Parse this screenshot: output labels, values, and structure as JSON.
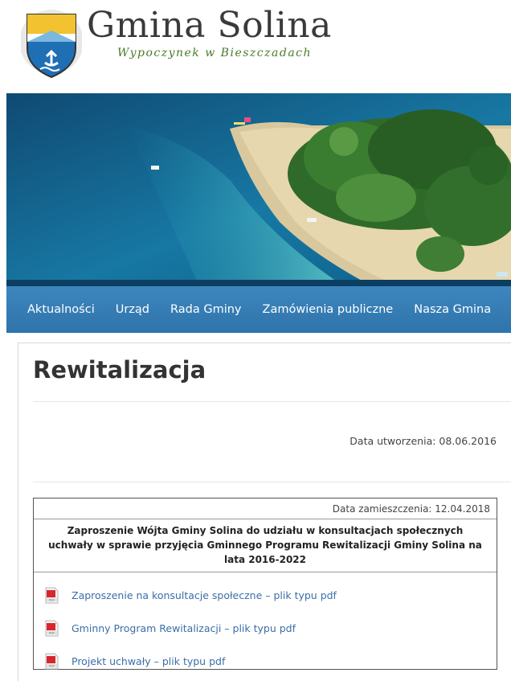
{
  "brand": {
    "title": "Gmina Solina",
    "subtitle": "Wypoczynek w Bieszczadach",
    "logo_icon": "crest-icon"
  },
  "nav": {
    "items": [
      {
        "label": "Aktualności"
      },
      {
        "label": "Urząd"
      },
      {
        "label": "Rada Gminy"
      },
      {
        "label": "Zamówienia publiczne"
      },
      {
        "label": "Nasza Gmina"
      }
    ],
    "color": "#357ab3"
  },
  "page": {
    "title": "Rewitalizacja",
    "created": "Data utworzenia: 08.06.2016"
  },
  "document": {
    "posted": "Data zamieszczenia: 12.04.2018",
    "title": "Zaproszenie Wójta Gminy Solina do udziału w konsultacjach społecznych uchwały w sprawie przyjęcia Gminnego Programu Rewitalizacji  Gminy  Solina na lata 2016-2022",
    "files": [
      {
        "label": "Zaproszenie na konsultacje społeczne – plik typu pdf",
        "icon": "pdf-icon"
      },
      {
        "label": "Gminny Program Rewitalizacji – plik typu pdf",
        "icon": "pdf-icon"
      },
      {
        "label": "Projekt uchwały – plik typu pdf",
        "icon": "pdf-icon"
      }
    ]
  },
  "colors": {
    "link": "#3b6ea8",
    "nav_bg": "#357ab3",
    "subtitle": "#4a7a2a"
  }
}
